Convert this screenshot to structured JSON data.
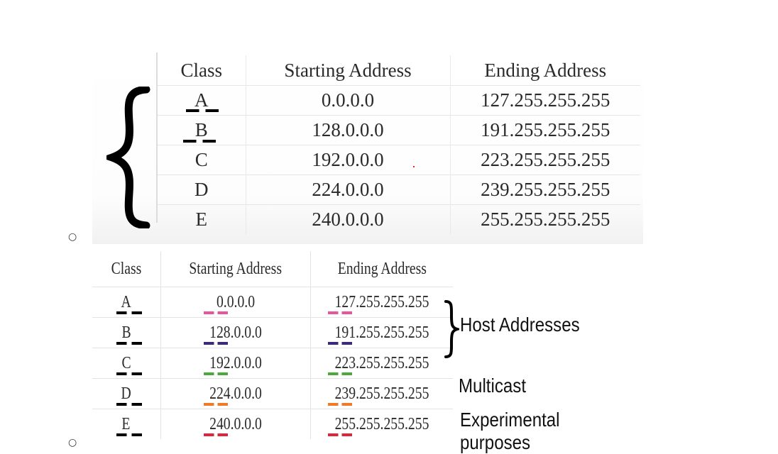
{
  "table1": {
    "headers": [
      "Class",
      "Starting Address",
      "Ending Address"
    ],
    "rows": [
      {
        "class": "A",
        "start": "0.0.0.0",
        "end": "127.255.255.255"
      },
      {
        "class": "B",
        "start": "128.0.0.0",
        "end": "191.255.255.255"
      },
      {
        "class": "C",
        "start": "192.0.0.0",
        "end": "223.255.255.255"
      },
      {
        "class": "D",
        "start": "224.0.0.0",
        "end": "239.255.255.255"
      },
      {
        "class": "E",
        "start": "240.0.0.0",
        "end": "255.255.255.255"
      }
    ]
  },
  "table2": {
    "headers": [
      "Class",
      "Starting Address",
      "Ending Address"
    ],
    "rows": [
      {
        "class": "A",
        "start": "0.0.0.0",
        "end": "127.255.255.255",
        "color": "#e8559a"
      },
      {
        "class": "B",
        "start": "128.0.0.0",
        "end": "191.255.255.255",
        "color": "#3b2a7a"
      },
      {
        "class": "C",
        "start": "192.0.0.0",
        "end": "223.255.255.255",
        "color": "#4caa3a"
      },
      {
        "class": "D",
        "start": "224.0.0.0",
        "end": "239.255.255.255",
        "color": "#f07a28"
      },
      {
        "class": "E",
        "start": "240.0.0.0",
        "end": "255.255.255.255",
        "color": "#e0243a"
      }
    ],
    "notes": {
      "host": "Host Addresses",
      "multicast": "Multicast",
      "experimental": "Experimental purposes"
    }
  },
  "bullets": [
    "○",
    "○"
  ]
}
